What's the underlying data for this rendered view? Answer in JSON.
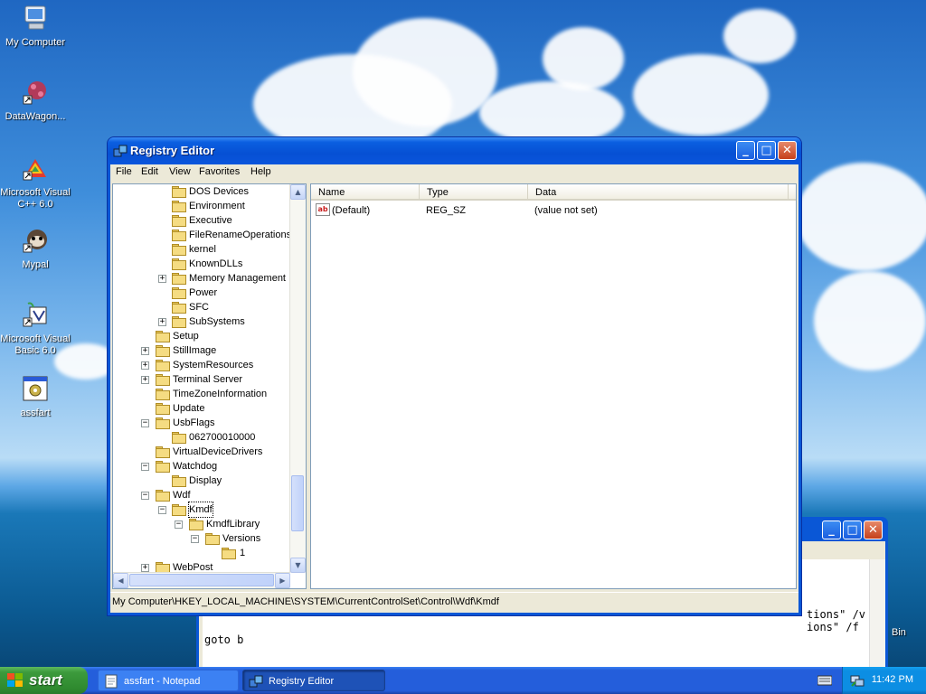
{
  "desktop": {
    "icons": [
      {
        "label": "My Computer"
      },
      {
        "label": "DataWagon..."
      },
      {
        "label_line1": "Microsoft Visual",
        "label_line2": "C++ 6.0"
      },
      {
        "label": "Mypal"
      },
      {
        "label_line1": "Microsoft Visual",
        "label_line2": "Basic 6.0"
      },
      {
        "label": "assfart"
      }
    ],
    "recycle_partial": "Bin"
  },
  "notepad": {
    "line1": "tions\" /v",
    "line2": "ions\" /f",
    "line3": "goto b"
  },
  "window": {
    "title": "Registry Editor",
    "menu": [
      "File",
      "Edit",
      "View",
      "Favorites",
      "Help"
    ],
    "tree": [
      {
        "label": "DOS Devices",
        "expander": ""
      },
      {
        "label": "Environment",
        "expander": ""
      },
      {
        "label": "Executive",
        "expander": ""
      },
      {
        "label": "FileRenameOperations",
        "expander": ""
      },
      {
        "label": "kernel",
        "expander": ""
      },
      {
        "label": "KnownDLLs",
        "expander": ""
      },
      {
        "label": "Memory Management",
        "expander": "+"
      },
      {
        "label": "Power",
        "expander": ""
      },
      {
        "label": "SFC",
        "expander": ""
      },
      {
        "label": "SubSystems",
        "expander": "+"
      },
      {
        "label": "Setup",
        "expander": ""
      },
      {
        "label": "StillImage",
        "expander": "+"
      },
      {
        "label": "SystemResources",
        "expander": "+"
      },
      {
        "label": "Terminal Server",
        "expander": "+"
      },
      {
        "label": "TimeZoneInformation",
        "expander": ""
      },
      {
        "label": "Update",
        "expander": ""
      },
      {
        "label": "UsbFlags",
        "expander": "−"
      },
      {
        "label": "062700010000",
        "expander": ""
      },
      {
        "label": "VirtualDeviceDrivers",
        "expander": ""
      },
      {
        "label": "Watchdog",
        "expander": "−"
      },
      {
        "label": "Display",
        "expander": ""
      },
      {
        "label": "Wdf",
        "expander": "−"
      },
      {
        "label": "Kmdf",
        "expander": "−"
      },
      {
        "label": "KmdfLibrary",
        "expander": "−"
      },
      {
        "label": "Versions",
        "expander": "−"
      },
      {
        "label": "1",
        "expander": ""
      },
      {
        "label": "WebPost",
        "expander": "+"
      }
    ],
    "columns": [
      "Name",
      "Type",
      "Data"
    ],
    "values": [
      {
        "name": "(Default)",
        "type": "REG_SZ",
        "data": "(value not set)",
        "icon": "ab"
      }
    ],
    "status": "My Computer\\HKEY_LOCAL_MACHINE\\SYSTEM\\CurrentControlSet\\Control\\Wdf\\Kmdf"
  },
  "taskbar": {
    "start_label": "start",
    "tasks": [
      {
        "label": "assfart - Notepad"
      },
      {
        "label": "Registry Editor"
      }
    ],
    "clock": "11:42 PM"
  },
  "colors": {
    "titlebar": "#0a55dc",
    "start": "#3c9a3c",
    "tray": "#0c8ee3"
  }
}
